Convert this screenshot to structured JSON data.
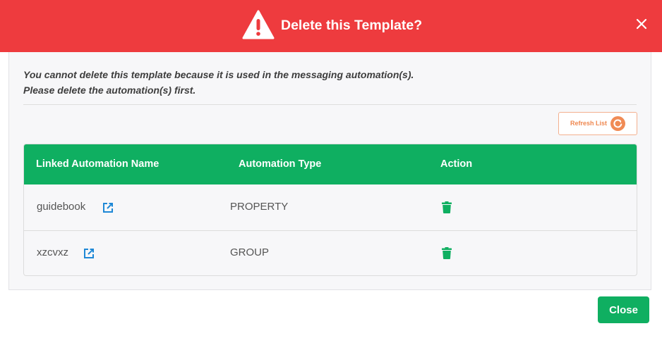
{
  "dialog": {
    "title": "Delete this Template?",
    "message_line1": "You cannot delete this template because it is used in the messaging automation(s).",
    "message_line2": "Please delete the automation(s) first.",
    "refresh_label": "Refresh List",
    "close_label": "Close"
  },
  "table": {
    "headers": [
      "Linked Automation Name",
      "Automation Type",
      "Action"
    ],
    "rows": [
      {
        "name": "guidebook",
        "type": "PROPERTY"
      },
      {
        "name": "xzcvxz",
        "type": "GROUP"
      }
    ]
  },
  "colors": {
    "header_bg": "#ee3b3e",
    "accent_green": "#0faf61",
    "refresh_orange": "#f08b55",
    "link_blue": "#1e88d6"
  },
  "icons": {
    "warning": "warning-triangle-icon",
    "close": "close-icon",
    "refresh": "refresh-icon",
    "external_link": "external-link-icon",
    "delete": "trash-icon"
  }
}
